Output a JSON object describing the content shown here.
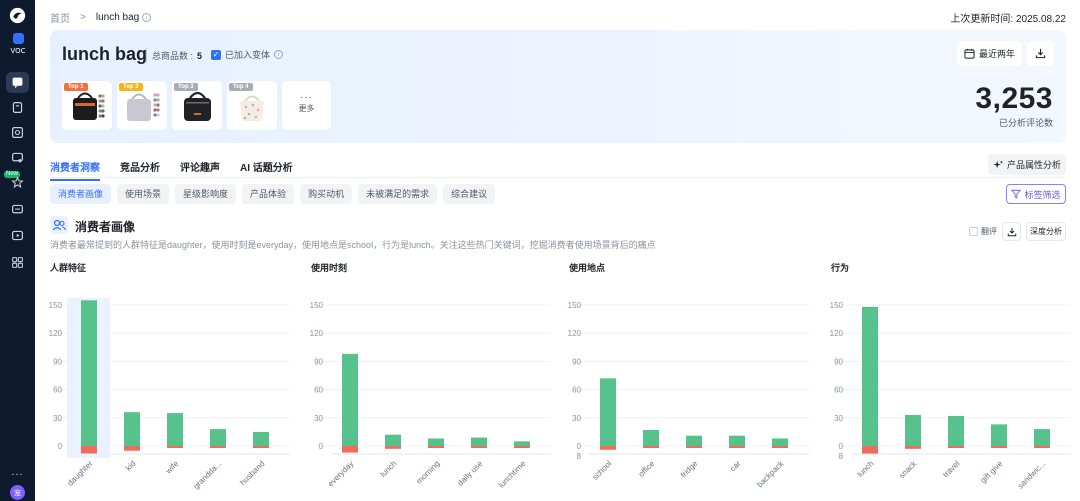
{
  "sidebar": {
    "voc_label": "VOC",
    "new_badge": "New",
    "more_label": "...",
    "avatar_text": "宠"
  },
  "breadcrumb": {
    "home": "首页",
    "separator": ">",
    "current": "lunch bag"
  },
  "updated": "上次更新时间: 2025.08.22",
  "hero": {
    "title": "lunch bag",
    "count_label": "总商品数 :",
    "count_value": "5",
    "variant_label": "已加入变体",
    "products": [
      {
        "badge": "Top 1",
        "badge_color": "#f5703c"
      },
      {
        "badge": "Top 2",
        "badge_color": "#f6b417"
      },
      {
        "badge": "Top 3",
        "badge_color": "#a7adb8"
      },
      {
        "badge": "Top 4",
        "badge_color": "#a7adb8"
      }
    ],
    "more_label": "更多",
    "period_label": "最近两年",
    "review_count": "3,253",
    "review_caption": "已分析评论数"
  },
  "tabs": [
    "消费者洞察",
    "竞品分析",
    "评论趣声",
    "AI 话题分析"
  ],
  "attr_button": "产品属性分析",
  "subtabs": [
    "消费者画像",
    "使用场景",
    "星级影响度",
    "产品体验",
    "购买动机",
    "未被满足的需求",
    "综合建议"
  ],
  "filter_button": "标签筛选",
  "section": {
    "title": "消费者画像",
    "description": "消费者最常提到的人群特征是daughter，使用时刻是everyday，使用地点是school，行为是lunch。关注这些热门关键词，挖掘消费者使用场景背后的痛点",
    "translate_label": "翻评",
    "deep_button": "深度分析"
  },
  "colors": {
    "positive": "#57c28c",
    "negative": "#ef6b5e",
    "accent": "#3370ff",
    "highlight": "#eaf1ff"
  },
  "chart_data": [
    {
      "type": "bar",
      "title": "人群特征",
      "categories": [
        "daughter",
        "kid",
        "wife",
        "grandda...",
        "husband"
      ],
      "yticks": [
        "150",
        "120",
        "90",
        "60",
        "30",
        "0"
      ],
      "ylim": [
        -8,
        150
      ],
      "series": [
        {
          "values": [
            155,
            36,
            35,
            18,
            15
          ]
        },
        {
          "values": [
            -8,
            -5,
            -1,
            -1,
            -1
          ]
        }
      ],
      "highlight": 0
    },
    {
      "type": "bar",
      "title": "使用时刻",
      "categories": [
        "everyday",
        "lunch",
        "morning",
        "daily use",
        "lunchtime"
      ],
      "yticks": [
        "150",
        "120",
        "90",
        "60",
        "30",
        "0"
      ],
      "ylim": [
        -8,
        150
      ],
      "series": [
        {
          "values": [
            98,
            12,
            8,
            9,
            5
          ]
        },
        {
          "values": [
            -7,
            -3,
            -2,
            -1,
            -1
          ]
        }
      ]
    },
    {
      "type": "bar",
      "title": "使用地点",
      "categories": [
        "school",
        "office",
        "fridge",
        "car",
        "backpack"
      ],
      "yticks": [
        "150",
        "120",
        "90",
        "60",
        "30",
        "0",
        "8"
      ],
      "ylim": [
        -8,
        150
      ],
      "series": [
        {
          "values": [
            72,
            17,
            11,
            11,
            8
          ]
        },
        {
          "values": [
            -4,
            -1,
            -1,
            -1,
            -1
          ]
        }
      ]
    },
    {
      "type": "bar",
      "title": "行为",
      "categories": [
        "lunch",
        "snack",
        "travel",
        "gift give",
        "sandwic..."
      ],
      "yticks": [
        "150",
        "120",
        "90",
        "60",
        "30",
        "0",
        "8"
      ],
      "ylim": [
        -8,
        150
      ],
      "series": [
        {
          "values": [
            148,
            33,
            32,
            23,
            18
          ]
        },
        {
          "values": [
            -8,
            -3,
            -1,
            -2,
            -1
          ]
        }
      ]
    }
  ]
}
